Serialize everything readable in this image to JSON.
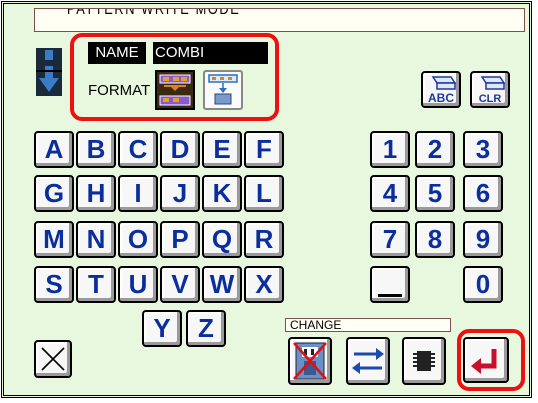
{
  "header": {
    "title": "PATTERN WRITE MODE"
  },
  "pattern": {
    "name_label": "NAME",
    "name_value": "COMBI",
    "format_label": "FORMAT"
  },
  "keyboard": {
    "letters": [
      "A",
      "B",
      "C",
      "D",
      "E",
      "F",
      "G",
      "H",
      "I",
      "J",
      "K",
      "L",
      "M",
      "N",
      "O",
      "P",
      "Q",
      "R",
      "S",
      "T",
      "U",
      "V",
      "W",
      "X",
      "Y",
      "Z"
    ],
    "digits": [
      "1",
      "2",
      "3",
      "4",
      "5",
      "6",
      "7",
      "8",
      "9",
      "0"
    ]
  },
  "abc_button_label": "ABC",
  "clr_button_label": "CLR",
  "change": {
    "label": "CHANGE"
  },
  "colors": {
    "background": "#e8f8de",
    "highlight": "#ee1111",
    "key_text": "#0a2e9e",
    "enter_arrow": "#c8102e"
  }
}
